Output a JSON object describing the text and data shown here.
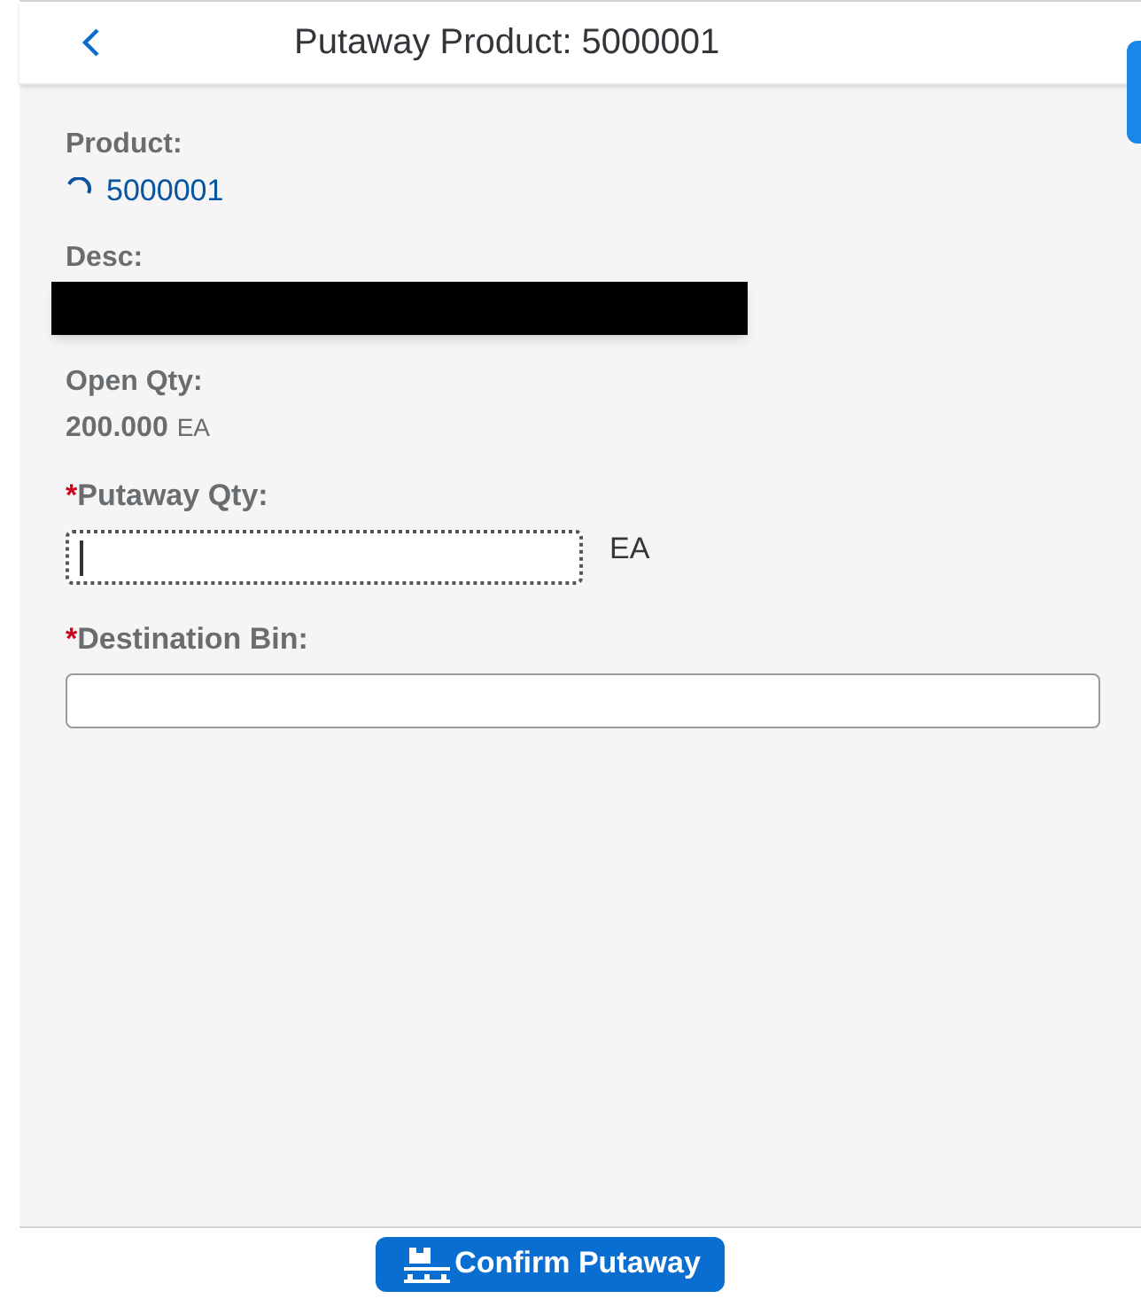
{
  "header": {
    "title": "Putaway Product: 5000001"
  },
  "product": {
    "label": "Product:",
    "value": "5000001"
  },
  "desc": {
    "label": "Desc:",
    "redacted": true
  },
  "open_qty": {
    "label": "Open Qty:",
    "value": "200.000",
    "unit": "EA"
  },
  "fields": [
    {
      "required_mark": "*",
      "label": "Putaway Qty:",
      "focused": true,
      "unit": "EA"
    },
    {
      "required_mark": "*",
      "label": "Destination Bin:",
      "focused": false
    }
  ],
  "footer": {
    "button": "Confirm Putaway"
  }
}
